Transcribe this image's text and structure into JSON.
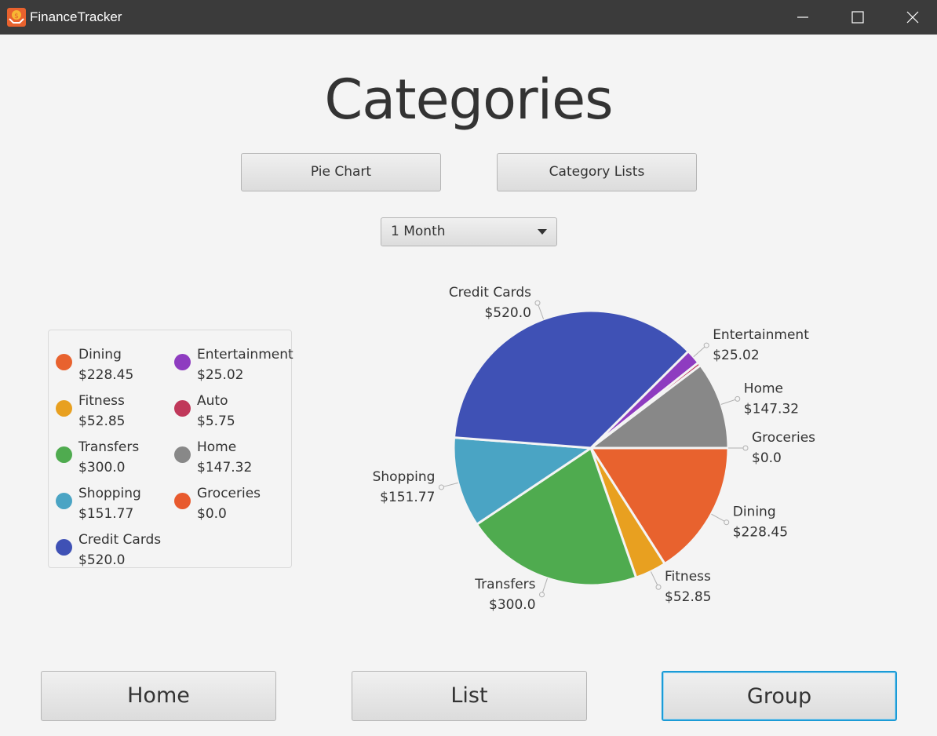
{
  "window": {
    "title": "FinanceTracker",
    "icon": "finance-app-icon"
  },
  "page": {
    "title": "Categories"
  },
  "view_buttons": {
    "pie_chart": "Pie Chart",
    "category_lists": "Category Lists"
  },
  "period_select": {
    "value": "1 Month"
  },
  "nav": {
    "home": "Home",
    "list": "List",
    "group": "Group"
  },
  "legend": [
    {
      "name": "Dining",
      "amount": "$228.45",
      "color": "#e8622e"
    },
    {
      "name": "Entertainment",
      "amount": "$25.02",
      "color": "#8e3cc0"
    },
    {
      "name": "Fitness",
      "amount": "$52.85",
      "color": "#e8a020"
    },
    {
      "name": "Auto",
      "amount": "$5.75",
      "color": "#c0385a"
    },
    {
      "name": "Transfers",
      "amount": "$300.0",
      "color": "#4fab4f"
    },
    {
      "name": "Home",
      "amount": "$147.32",
      "color": "#888888"
    },
    {
      "name": "Shopping",
      "amount": "$151.77",
      "color": "#4aa4c4"
    },
    {
      "name": "Groceries",
      "amount": "$0.0",
      "color": "#e85a2e"
    },
    {
      "name": "Credit Cards",
      "amount": "$520.0",
      "color": "#3f51b5"
    }
  ],
  "chart_data": {
    "type": "pie",
    "title": "",
    "start_angle_deg": 0,
    "direction": "clockwise",
    "slices": [
      {
        "name": "Dining",
        "value": 228.45,
        "label": "$228.45",
        "color": "#e8622e",
        "labeled": true
      },
      {
        "name": "Fitness",
        "value": 52.85,
        "label": "$52.85",
        "color": "#e8a020",
        "labeled": true
      },
      {
        "name": "Transfers",
        "value": 300.0,
        "label": "$300.0",
        "color": "#4fab4f",
        "labeled": true
      },
      {
        "name": "Shopping",
        "value": 151.77,
        "label": "$151.77",
        "color": "#4aa4c4",
        "labeled": true
      },
      {
        "name": "Credit Cards",
        "value": 520.0,
        "label": "$520.0",
        "color": "#3f51b5",
        "labeled": true
      },
      {
        "name": "Entertainment",
        "value": 25.02,
        "label": "$25.02",
        "color": "#8e3cc0",
        "labeled": true
      },
      {
        "name": "Auto",
        "value": 5.75,
        "label": "$5.75",
        "color": "#c0385a",
        "labeled": false
      },
      {
        "name": "Home",
        "value": 147.32,
        "label": "$147.32",
        "color": "#888888",
        "labeled": true
      },
      {
        "name": "Groceries",
        "value": 0.0,
        "label": "$0.0",
        "color": "#e85a2e",
        "labeled": true
      }
    ]
  }
}
